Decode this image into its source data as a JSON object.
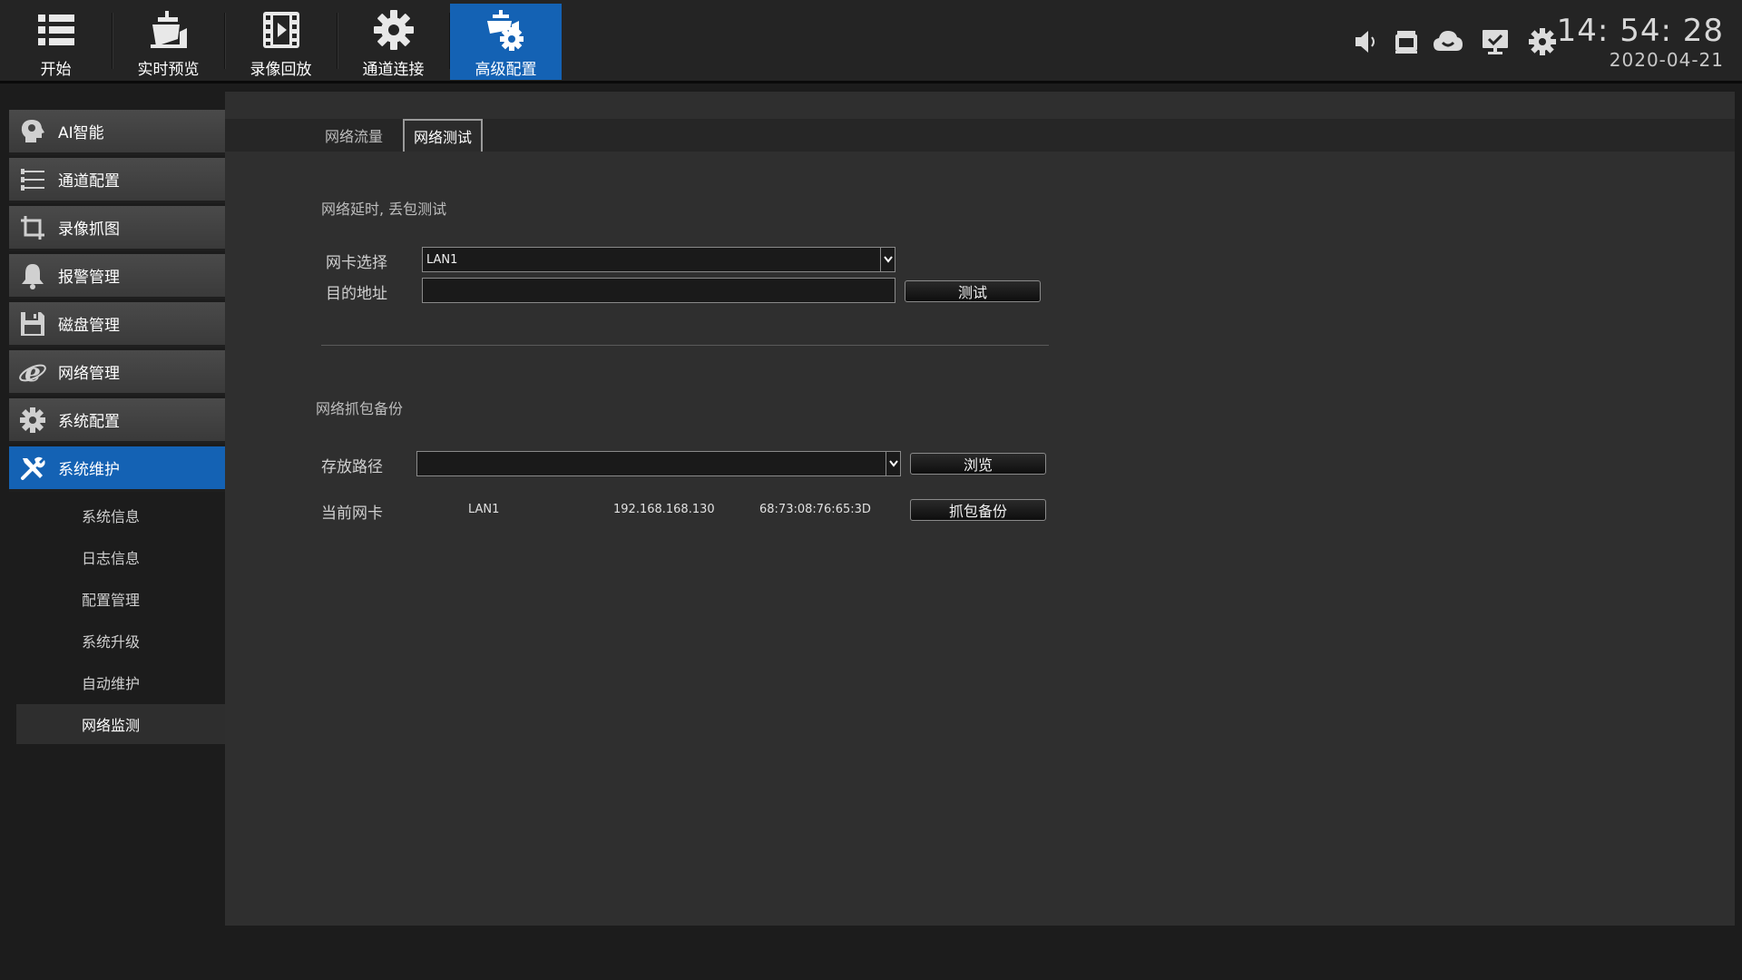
{
  "topnav": {
    "items": [
      {
        "label": "开始",
        "icon": "list-icon"
      },
      {
        "label": "实时预览",
        "icon": "camera-icon"
      },
      {
        "label": "录像回放",
        "icon": "film-icon"
      },
      {
        "label": "通道连接",
        "icon": "gear-icon"
      },
      {
        "label": "高级配置",
        "icon": "camera-gear-icon"
      }
    ],
    "active_index": 4
  },
  "tray": {
    "icons": [
      "speaker-icon",
      "recorder-icon",
      "cloud-icon",
      "monitor-icon",
      "settings-icon"
    ]
  },
  "clock": {
    "time": "14: 54: 28",
    "date": "2020-04-21"
  },
  "sidebar": {
    "items": [
      {
        "label": "AI智能",
        "icon": "ai-head-icon"
      },
      {
        "label": "通道配置",
        "icon": "sliders-icon"
      },
      {
        "label": "录像抓图",
        "icon": "crop-icon"
      },
      {
        "label": "报警管理",
        "icon": "bell-icon"
      },
      {
        "label": "磁盘管理",
        "icon": "disk-icon"
      },
      {
        "label": "网络管理",
        "icon": "ie-icon"
      },
      {
        "label": "系统配置",
        "icon": "gear-icon"
      },
      {
        "label": "系统维护",
        "icon": "tools-icon"
      }
    ],
    "active_index": 7,
    "subitems": [
      "系统信息",
      "日志信息",
      "配置管理",
      "系统升级",
      "自动维护",
      "网络监测"
    ],
    "active_subindex": 5
  },
  "tabs": {
    "items": [
      "网络流量",
      "网络测试"
    ],
    "active_index": 1
  },
  "test_section": {
    "title": "网络延时, 丢包测试",
    "nic_label": "网卡选择",
    "nic_value": "LAN1",
    "dest_label": "目的地址",
    "dest_value": "",
    "test_button": "测试"
  },
  "capture_section": {
    "title": "网络抓包备份",
    "path_label": "存放路径",
    "path_value": "",
    "browse_button": "浏览",
    "current_nic_label": "当前网卡",
    "current_nic": "LAN1",
    "ip": "192.168.168.130",
    "mac": "68:73:08:76:65:3D",
    "backup_button": "抓包备份"
  },
  "colors": {
    "accent": "#1462b4",
    "background": "#1c1c1c",
    "panel": "#2f2f2f"
  }
}
